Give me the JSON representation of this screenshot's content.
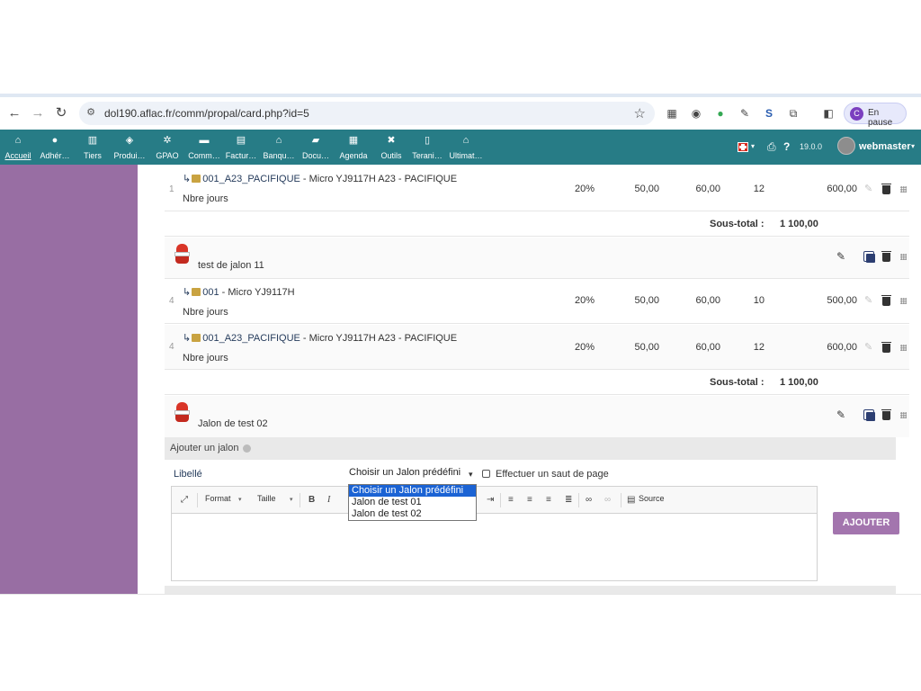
{
  "browser": {
    "url": "dol190.aflac.fr/comm/propal/card.php?id=5",
    "profile_initial": "C",
    "profile_status": "En pause"
  },
  "topmenu": {
    "items": [
      {
        "label": "Accueil",
        "icon": "home-icon"
      },
      {
        "label": "Adhér…",
        "icon": "member-icon"
      },
      {
        "label": "Tiers",
        "icon": "building-icon"
      },
      {
        "label": "Produi…",
        "icon": "cube-icon"
      },
      {
        "label": "GPAO",
        "icon": "cogs-icon"
      },
      {
        "label": "Comm…",
        "icon": "suitcase-icon"
      },
      {
        "label": "Factur…",
        "icon": "invoice-icon"
      },
      {
        "label": "Banqu…",
        "icon": "bank-icon"
      },
      {
        "label": "Docu…",
        "icon": "folder-icon"
      },
      {
        "label": "Agenda",
        "icon": "calendar-icon"
      },
      {
        "label": "Outils",
        "icon": "tools-icon"
      },
      {
        "label": "Terani…",
        "icon": "file-icon"
      },
      {
        "label": "Ultimat…",
        "icon": "ultimate-icon"
      }
    ],
    "version": "19.0.0",
    "user": "webmaster"
  },
  "lines": [
    {
      "rank": "1",
      "ref": "001_A23_PACIFIQUE",
      "desc": " - Micro YJ9117H A23 - PACIFIQUE",
      "sub": "Nbre jours",
      "tva": "20%",
      "pu_ht": "50,00",
      "pu_ttc": "60,00",
      "qty": "12",
      "total": "600,00"
    },
    {
      "rank": "4",
      "ref": "001",
      "desc": " - Micro YJ9117H",
      "sub": "Nbre jours",
      "tva": "20%",
      "pu_ht": "50,00",
      "pu_ttc": "60,00",
      "qty": "10",
      "total": "500,00"
    },
    {
      "rank": "4",
      "ref": "001_A23_PACIFIQUE",
      "desc": " - Micro YJ9117H A23 - PACIFIQUE",
      "sub": "Nbre jours",
      "tva": "20%",
      "pu_ht": "50,00",
      "pu_ttc": "60,00",
      "qty": "12",
      "total": "600,00"
    }
  ],
  "subtotals": [
    {
      "label": "Sous-total :",
      "value": "1 100,00"
    },
    {
      "label": "Sous-total :",
      "value": "1 100,00"
    }
  ],
  "milestones": [
    {
      "label": "test de jalon 11"
    },
    {
      "label": "Jalon de test 02"
    }
  ],
  "form": {
    "title": "Ajouter un jalon",
    "libelle_label": "Libellé",
    "select_value": "Choisir un Jalon prédéfini",
    "select_options": [
      "Choisir un Jalon prédéfini",
      "Jalon de test 01",
      "Jalon de test 02"
    ],
    "checkbox_label": "Effectuer un saut de page",
    "submit_label": "AJOUTER"
  },
  "editor": {
    "format_label": "Format",
    "size_label": "Taille",
    "source_label": "Source"
  },
  "colors": {
    "menu_bg": "#277c86",
    "left_panel": "#986ea3",
    "button": "#a375ae",
    "link": "#263c5c",
    "select_highlight": "#1b63d4"
  }
}
